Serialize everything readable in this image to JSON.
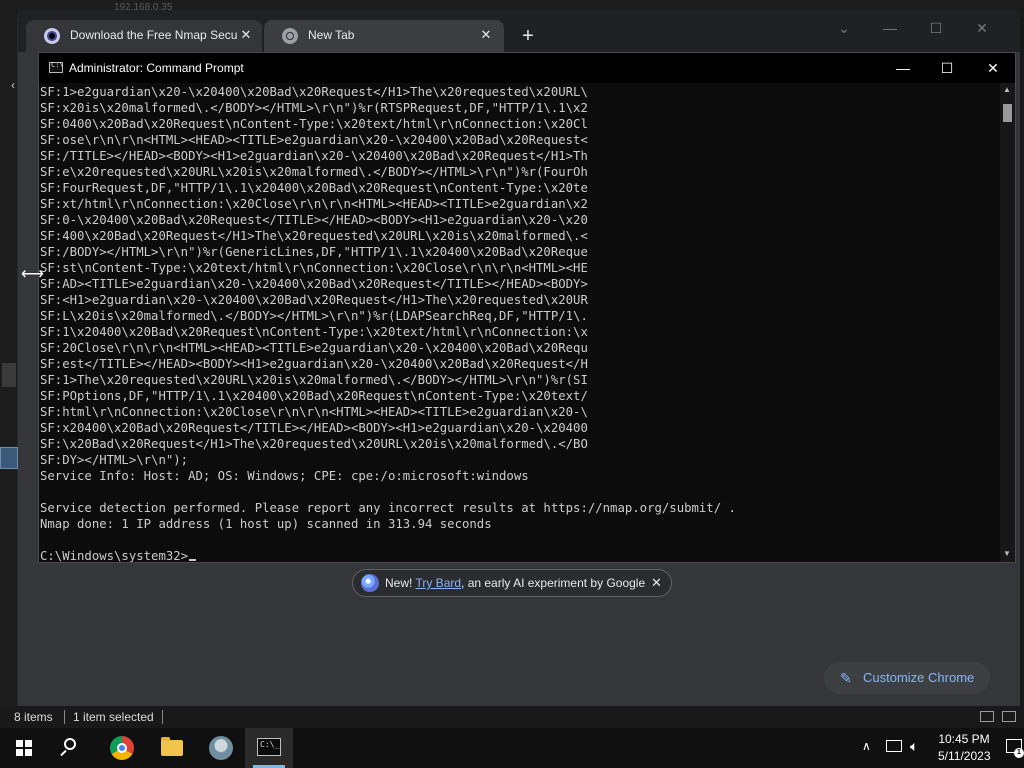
{
  "desktop": {
    "host_ip": "192.168.0.35"
  },
  "chrome": {
    "tabs": [
      {
        "title": "Download the Free Nmap Security Scanner",
        "active": false
      },
      {
        "title": "New Tab",
        "active": true
      }
    ],
    "promo": {
      "prefix": "New! ",
      "link": "Try Bard",
      "suffix": ", an early AI experiment by Google"
    },
    "customize_label": "Customize Chrome"
  },
  "cmd": {
    "title": "Administrator: Command Prompt",
    "lines": [
      "SF:1>e2guardian\\x20-\\x20400\\x20Bad\\x20Request</H1>The\\x20requested\\x20URL\\",
      "SF:x20is\\x20malformed\\.</BODY></HTML>\\r\\n\")%r(RTSPRequest,DF,\"HTTP/1\\.1\\x2",
      "SF:0400\\x20Bad\\x20Request\\nContent-Type:\\x20text/html\\r\\nConnection:\\x20Cl",
      "SF:ose\\r\\n\\r\\n<HTML><HEAD><TITLE>e2guardian\\x20-\\x20400\\x20Bad\\x20Request<",
      "SF:/TITLE></HEAD><BODY><H1>e2guardian\\x20-\\x20400\\x20Bad\\x20Request</H1>Th",
      "SF:e\\x20requested\\x20URL\\x20is\\x20malformed\\.</BODY></HTML>\\r\\n\")%r(FourOh",
      "SF:FourRequest,DF,\"HTTP/1\\.1\\x20400\\x20Bad\\x20Request\\nContent-Type:\\x20te",
      "SF:xt/html\\r\\nConnection:\\x20Close\\r\\n\\r\\n<HTML><HEAD><TITLE>e2guardian\\x2",
      "SF:0-\\x20400\\x20Bad\\x20Request</TITLE></HEAD><BODY><H1>e2guardian\\x20-\\x20",
      "SF:400\\x20Bad\\x20Request</H1>The\\x20requested\\x20URL\\x20is\\x20malformed\\.<",
      "SF:/BODY></HTML>\\r\\n\")%r(GenericLines,DF,\"HTTP/1\\.1\\x20400\\x20Bad\\x20Reque",
      "SF:st\\nContent-Type:\\x20text/html\\r\\nConnection:\\x20Close\\r\\n\\r\\n<HTML><HE",
      "SF:AD><TITLE>e2guardian\\x20-\\x20400\\x20Bad\\x20Request</TITLE></HEAD><BODY>",
      "SF:<H1>e2guardian\\x20-\\x20400\\x20Bad\\x20Request</H1>The\\x20requested\\x20UR",
      "SF:L\\x20is\\x20malformed\\.</BODY></HTML>\\r\\n\")%r(LDAPSearchReq,DF,\"HTTP/1\\.",
      "SF:1\\x20400\\x20Bad\\x20Request\\nContent-Type:\\x20text/html\\r\\nConnection:\\x",
      "SF:20Close\\r\\n\\r\\n<HTML><HEAD><TITLE>e2guardian\\x20-\\x20400\\x20Bad\\x20Requ",
      "SF:est</TITLE></HEAD><BODY><H1>e2guardian\\x20-\\x20400\\x20Bad\\x20Request</H",
      "SF:1>The\\x20requested\\x20URL\\x20is\\x20malformed\\.</BODY></HTML>\\r\\n\")%r(SI",
      "SF:POptions,DF,\"HTTP/1\\.1\\x20400\\x20Bad\\x20Request\\nContent-Type:\\x20text/",
      "SF:html\\r\\nConnection:\\x20Close\\r\\n\\r\\n<HTML><HEAD><TITLE>e2guardian\\x20-\\",
      "SF:x20400\\x20Bad\\x20Request</TITLE></HEAD><BODY><H1>e2guardian\\x20-\\x20400",
      "SF:\\x20Bad\\x20Request</H1>The\\x20requested\\x20URL\\x20is\\x20malformed\\.</BO",
      "SF:DY></HTML>\\r\\n\");",
      "Service Info: Host: AD; OS: Windows; CPE: cpe:/o:microsoft:windows",
      "",
      "Service detection performed. Please report any incorrect results at https://nmap.org/submit/ .",
      "Nmap done: 1 IP address (1 host up) scanned in 313.94 seconds",
      ""
    ],
    "prompt": "C:\\Windows\\system32>"
  },
  "explorer_status": {
    "item_count": "8 items",
    "selected": "1 item selected"
  },
  "taskbar": {
    "apps": [
      "start",
      "search",
      "google-chrome",
      "file-explorer",
      "wireshark",
      "command-prompt"
    ],
    "active_app": "command-prompt",
    "time": "10:45 PM",
    "date": "5/11/2023",
    "notification_count": "1"
  },
  "colors": {
    "console_bg": "#0c0c0c",
    "console_fg": "#cccccc",
    "chrome_accent": "#8ab4f8",
    "taskbar_bg": "#101010"
  }
}
